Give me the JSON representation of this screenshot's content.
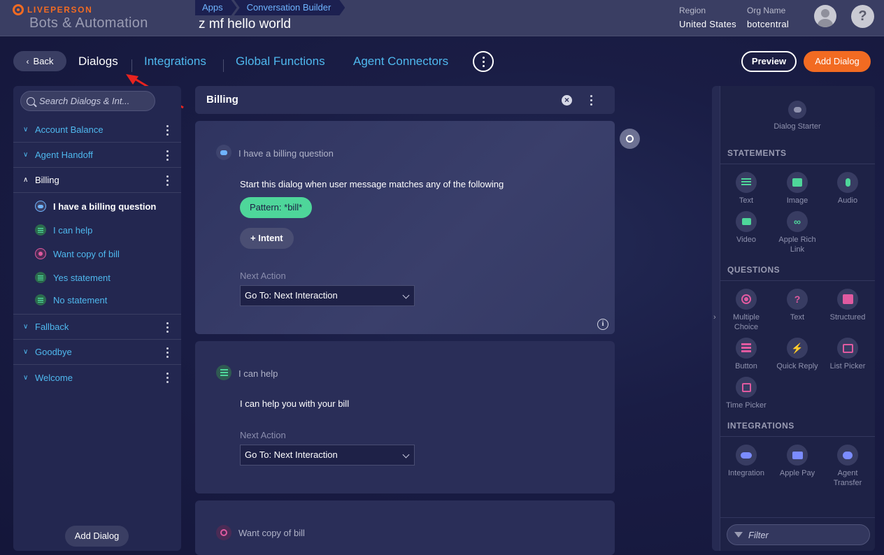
{
  "header": {
    "brand": "LIVEPERSON",
    "product": "Bots & Automation",
    "breadcrumbs": [
      "Apps",
      "Conversation Builder"
    ],
    "bot_name": "z mf hello world",
    "region_label": "Region",
    "region_value": "United States",
    "org_label": "Org Name",
    "org_value": "botcentral",
    "help": "?"
  },
  "nav": {
    "back": "Back",
    "tabs": [
      "Dialogs",
      "Integrations",
      "Global Functions",
      "Agent Connectors"
    ],
    "active_tab": "Dialogs",
    "preview": "Preview",
    "add_dialog": "Add Dialog"
  },
  "sidebar": {
    "search_placeholder": "Search Dialogs & Int...",
    "dialogs": [
      "Account Balance",
      "Agent Handoff",
      "Billing",
      "Fallback",
      "Goodbye",
      "Welcome"
    ],
    "billing_items": [
      "I have a billing question",
      "I can help",
      "Want copy of bill",
      "Yes statement",
      "No statement"
    ],
    "add_dialog": "Add Dialog"
  },
  "canvas": {
    "dialog_title": "Billing",
    "card1": {
      "title": "I have a billing question",
      "text": "Start this dialog when user message matches any of the following",
      "pattern": "Pattern:  *bill*",
      "intent_button": "+ Intent",
      "next_action_label": "Next Action",
      "next_action_value": "Go To: Next Interaction"
    },
    "card2": {
      "title": "I can help",
      "text": "I can help you with your bill",
      "next_action_label": "Next Action",
      "next_action_value": "Go To: Next Interaction"
    },
    "card3": {
      "title": "Want copy of bill"
    }
  },
  "palette": {
    "dialog_starter": "Dialog Starter",
    "statements_header": "STATEMENTS",
    "statements": [
      "Text",
      "Image",
      "Audio",
      "Video",
      "Apple Rich Link"
    ],
    "questions_header": "QUESTIONS",
    "questions": [
      "Multiple Choice",
      "Text",
      "Structured",
      "Button",
      "Quick Reply",
      "List Picker",
      "Time Picker"
    ],
    "integrations_header": "INTEGRATIONS",
    "integrations": [
      "Integration",
      "Apple Pay",
      "Agent Transfer"
    ],
    "filter_placeholder": "Filter"
  },
  "colors": {
    "accent_orange": "#f26b22",
    "link_blue": "#4fb8ee",
    "green": "#4ed69a",
    "pink": "#e05aa0",
    "annotation_red": "#e8231f"
  }
}
